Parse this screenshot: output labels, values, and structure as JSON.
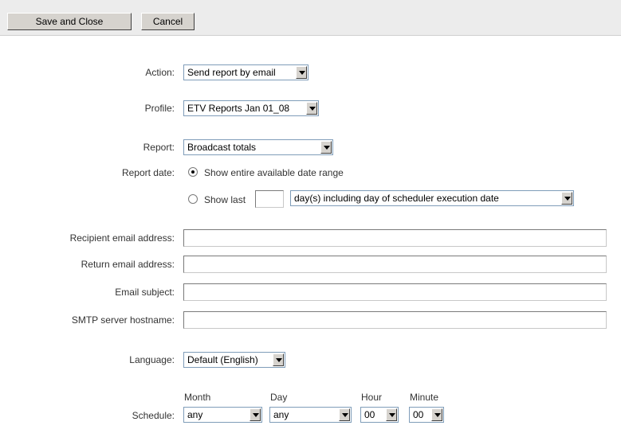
{
  "toolbar": {
    "save_label": "Save and Close",
    "cancel_label": "Cancel"
  },
  "form": {
    "action": {
      "label": "Action:",
      "value": "Send report by email"
    },
    "profile": {
      "label": "Profile:",
      "value": "ETV Reports Jan 01_08"
    },
    "report": {
      "label": "Report:",
      "value": "Broadcast totals"
    },
    "report_date": {
      "label": "Report date:",
      "option_range": "Show entire available date range",
      "option_last": "Show last",
      "days_value": "",
      "days_select": "day(s) including day of scheduler execution date",
      "selected": "range"
    },
    "recipient": {
      "label": "Recipient email address:",
      "value": ""
    },
    "return_email": {
      "label": "Return email address:",
      "value": ""
    },
    "subject": {
      "label": "Email subject:",
      "value": ""
    },
    "smtp": {
      "label": "SMTP server hostname:",
      "value": ""
    },
    "language": {
      "label": "Language:",
      "value": "Default (English)"
    },
    "schedule": {
      "label": "Schedule:",
      "month": {
        "caption": "Month",
        "value": "any"
      },
      "day": {
        "caption": "Day",
        "value": "any"
      },
      "hour": {
        "caption": "Hour",
        "value": "00"
      },
      "minute": {
        "caption": "Minute",
        "value": "00"
      }
    }
  }
}
